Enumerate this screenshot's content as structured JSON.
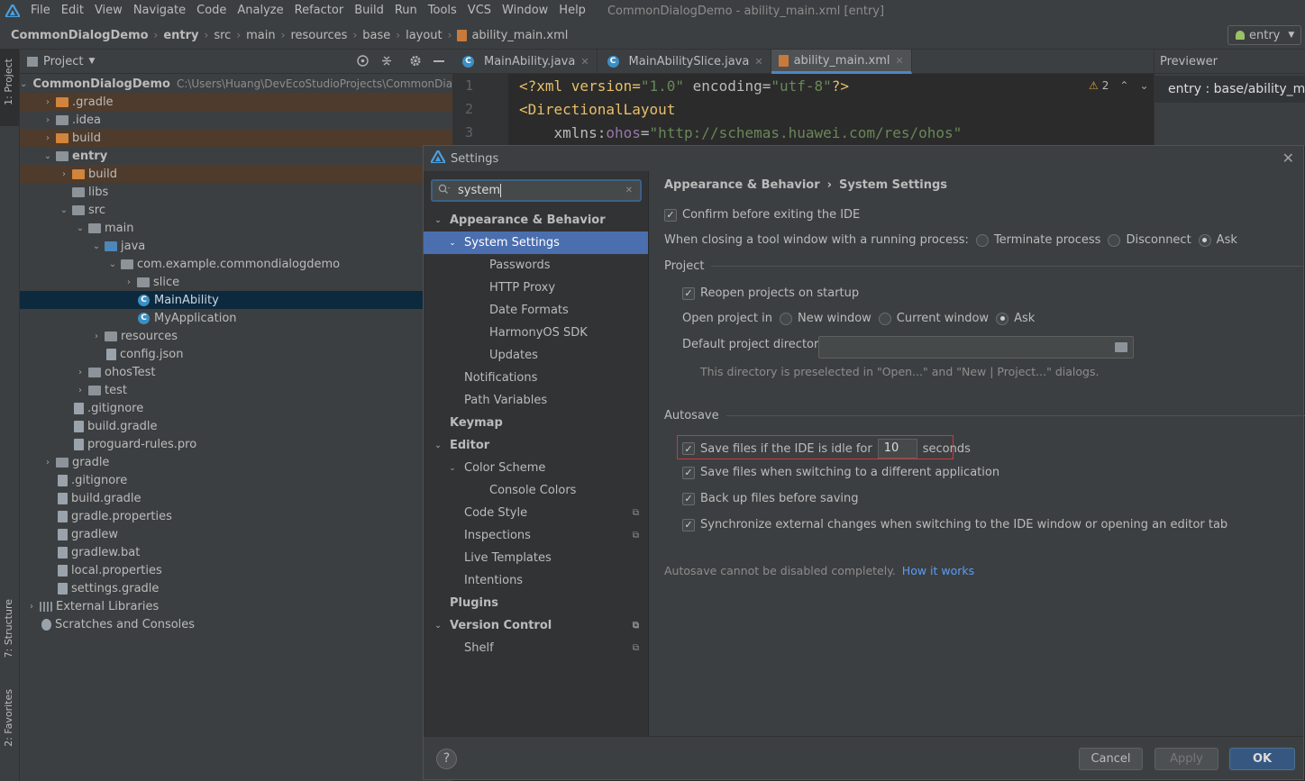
{
  "menubar": {
    "items": [
      "File",
      "Edit",
      "View",
      "Navigate",
      "Code",
      "Analyze",
      "Refactor",
      "Build",
      "Run",
      "Tools",
      "VCS",
      "Window",
      "Help"
    ],
    "title": "CommonDialogDemo - ability_main.xml [entry]"
  },
  "navbar": {
    "crumbs": [
      "CommonDialogDemo",
      "entry",
      "src",
      "main",
      "resources",
      "base",
      "layout",
      "ability_main.xml"
    ],
    "run_config": "entry"
  },
  "left_stripe": {
    "project": "1: Project",
    "structure": "7: Structure",
    "favorites": "2: Favorites"
  },
  "project_panel": {
    "header": "Project",
    "root_path": "C:\\Users\\Huang\\DevEcoStudioProjects\\CommonDia",
    "tree": [
      {
        "label": "CommonDialogDemo",
        "depth": 0,
        "arrow": "open",
        "icon": "folder-grey",
        "bold": true
      },
      {
        "label": ".gradle",
        "depth": 1,
        "arrow": "closed",
        "icon": "folder-orange",
        "hl": "orange"
      },
      {
        "label": ".idea",
        "depth": 1,
        "arrow": "closed",
        "icon": "folder-grey"
      },
      {
        "label": "build",
        "depth": 1,
        "arrow": "closed",
        "icon": "folder-orange",
        "hl": "orange"
      },
      {
        "label": "entry",
        "depth": 1,
        "arrow": "open",
        "icon": "folder-grey",
        "bold": true
      },
      {
        "label": "build",
        "depth": 2,
        "arrow": "closed",
        "icon": "folder-orange",
        "hl": "orange"
      },
      {
        "label": "libs",
        "depth": 2,
        "arrow": "none",
        "icon": "folder-grey"
      },
      {
        "label": "src",
        "depth": 2,
        "arrow": "open",
        "icon": "folder-grey"
      },
      {
        "label": "main",
        "depth": 3,
        "arrow": "open",
        "icon": "folder-grey"
      },
      {
        "label": "java",
        "depth": 4,
        "arrow": "open",
        "icon": "folder-blue"
      },
      {
        "label": "com.example.commondialogdemo",
        "depth": 5,
        "arrow": "open",
        "icon": "folder-grey"
      },
      {
        "label": "slice",
        "depth": 6,
        "arrow": "closed",
        "icon": "folder-grey"
      },
      {
        "label": "MainAbility",
        "depth": 6,
        "arrow": "none",
        "icon": "class",
        "hl": "sel"
      },
      {
        "label": "MyApplication",
        "depth": 6,
        "arrow": "none",
        "icon": "class"
      },
      {
        "label": "resources",
        "depth": 4,
        "arrow": "closed",
        "icon": "folder-grey"
      },
      {
        "label": "config.json",
        "depth": 4,
        "arrow": "none",
        "icon": "file"
      },
      {
        "label": "ohosTest",
        "depth": 3,
        "arrow": "closed",
        "icon": "folder-grey"
      },
      {
        "label": "test",
        "depth": 3,
        "arrow": "closed",
        "icon": "folder-grey"
      },
      {
        "label": ".gitignore",
        "depth": 2,
        "arrow": "none",
        "icon": "file"
      },
      {
        "label": "build.gradle",
        "depth": 2,
        "arrow": "none",
        "icon": "file"
      },
      {
        "label": "proguard-rules.pro",
        "depth": 2,
        "arrow": "none",
        "icon": "file"
      },
      {
        "label": "gradle",
        "depth": 1,
        "arrow": "closed",
        "icon": "folder-grey"
      },
      {
        "label": ".gitignore",
        "depth": 1,
        "arrow": "none",
        "icon": "file"
      },
      {
        "label": "build.gradle",
        "depth": 1,
        "arrow": "none",
        "icon": "file"
      },
      {
        "label": "gradle.properties",
        "depth": 1,
        "arrow": "none",
        "icon": "file"
      },
      {
        "label": "gradlew",
        "depth": 1,
        "arrow": "none",
        "icon": "file"
      },
      {
        "label": "gradlew.bat",
        "depth": 1,
        "arrow": "none",
        "icon": "file"
      },
      {
        "label": "local.properties",
        "depth": 1,
        "arrow": "none",
        "icon": "file"
      },
      {
        "label": "settings.gradle",
        "depth": 1,
        "arrow": "none",
        "icon": "file"
      },
      {
        "label": "External Libraries",
        "depth": 0,
        "arrow": "closed",
        "icon": "libs"
      },
      {
        "label": "Scratches and Consoles",
        "depth": 0,
        "arrow": "none",
        "icon": "scratch"
      }
    ]
  },
  "editor": {
    "tabs": [
      {
        "label": "MainAbility.java",
        "active": false
      },
      {
        "label": "MainAbilitySlice.java",
        "active": false
      },
      {
        "label": "ability_main.xml",
        "active": true
      }
    ],
    "line_numbers": [
      "1",
      "2",
      "3"
    ],
    "lines": [
      [
        "<?xml version=",
        "\"1.0\"",
        " encoding=",
        "\"utf-8\"",
        "?>"
      ],
      [
        "<DirectionalLayout"
      ],
      [
        "    xmlns:",
        "ohos",
        "=",
        "\"http://schemas.huawei.com/res/ohos\""
      ]
    ],
    "warning_count": "2"
  },
  "previewer": {
    "title": "Previewer",
    "item": "entry : base/ability_main"
  },
  "dialog": {
    "title": "Settings",
    "search_value": "system",
    "nav": [
      {
        "label": "Appearance & Behavior",
        "level": 0,
        "tri": "open",
        "bold": true
      },
      {
        "label": "System Settings",
        "level": 1,
        "tri": "open",
        "selected": true
      },
      {
        "label": "Passwords",
        "level": 2
      },
      {
        "label": "HTTP Proxy",
        "level": 2
      },
      {
        "label": "Date Formats",
        "level": 2
      },
      {
        "label": "HarmonyOS SDK",
        "level": 2
      },
      {
        "label": "Updates",
        "level": 2
      },
      {
        "label": "Notifications",
        "level": 1
      },
      {
        "label": "Path Variables",
        "level": 1
      },
      {
        "label": "Keymap",
        "level": 0,
        "bold": true
      },
      {
        "label": "Editor",
        "level": 0,
        "tri": "open",
        "bold": true
      },
      {
        "label": "Color Scheme",
        "level": 1,
        "tri": "open"
      },
      {
        "label": "Console Colors",
        "level": 2
      },
      {
        "label": "Code Style",
        "level": 1,
        "page_icon": true
      },
      {
        "label": "Inspections",
        "level": 1,
        "page_icon": true
      },
      {
        "label": "Live Templates",
        "level": 1
      },
      {
        "label": "Intentions",
        "level": 1
      },
      {
        "label": "Plugins",
        "level": 0,
        "bold": true
      },
      {
        "label": "Version Control",
        "level": 0,
        "tri": "open",
        "bold": true,
        "page_icon": true
      },
      {
        "label": "Shelf",
        "level": 1,
        "page_icon": true
      }
    ],
    "breadcrumb": [
      "Appearance & Behavior",
      "›",
      "System Settings"
    ],
    "confirm_exit": "Confirm before exiting the IDE",
    "closing_label": "When closing a tool window with a running process:",
    "closing_options": [
      "Terminate process",
      "Disconnect",
      "Ask"
    ],
    "closing_selected": "Ask",
    "project_section": "Project",
    "reopen": "Reopen projects on startup",
    "open_project_label": "Open project in",
    "open_options": [
      "New window",
      "Current window",
      "Ask"
    ],
    "open_selected": "Ask",
    "default_dir_label": "Default project directory:",
    "default_dir_value": "",
    "default_dir_hint": "This directory is preselected in \"Open...\" and \"New | Project...\" dialogs.",
    "autosave_section": "Autosave",
    "save_idle_label": "Save files if the IDE is idle for",
    "save_idle_value": "10",
    "save_idle_unit": "seconds",
    "save_switch": "Save files when switching to a different application",
    "backup": "Back up files before saving",
    "sync": "Synchronize external changes when switching to the IDE window or opening an editor tab",
    "autosave_note": "Autosave cannot be disabled completely.",
    "how_link": "How it works",
    "buttons": {
      "cancel": "Cancel",
      "apply": "Apply",
      "ok": "OK"
    },
    "help": "?"
  },
  "colors": {
    "accent": "#4b6eaf",
    "highlight_box": "#c93b3b",
    "link": "#589df6"
  }
}
